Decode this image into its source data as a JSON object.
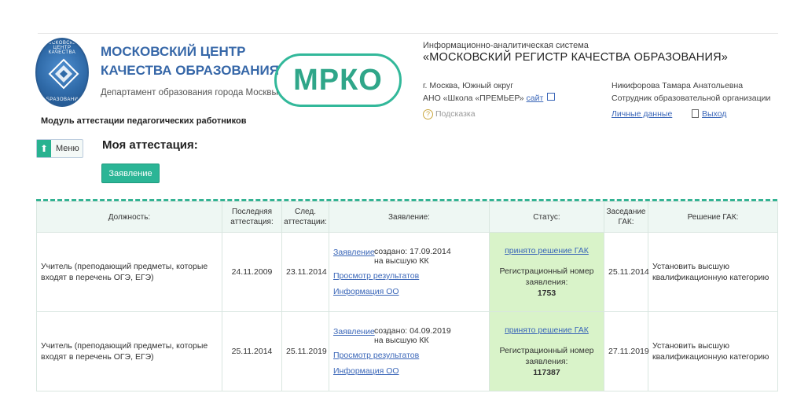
{
  "logo": {
    "ring_top": "МОСКОВСКИЙ ЦЕНТР КАЧЕСТВА",
    "ring_bottom": "ОБРАЗОВАНИЯ"
  },
  "header": {
    "org_line1": "МОСКОВСКИЙ ЦЕНТР",
    "org_line2": "КАЧЕСТВА ОБРАЗОВАНИЯ",
    "org_dept": "Департамент образования города Москвы",
    "mrko": "МРКО",
    "system_subtitle": "Информационно-аналитическая система",
    "system_title": "«МОСКОВСКИЙ РЕГИСТР КАЧЕСТВА ОБРАЗОВАНИЯ»",
    "location": "г. Москва, Южный округ",
    "school": "АНО «Школа «ПРЕМЬЕР»",
    "site_link": "сайт",
    "user_name": "Никифорова Тамара Анатольевна",
    "user_role": "Сотрудник образовательной организации",
    "hint": "Подсказка",
    "personal_data": "Личные данные",
    "exit": "Выход",
    "module_title": "Модуль аттестации педагогических работников"
  },
  "controls": {
    "menu_label": "Меню",
    "page_title": "Моя аттестация:",
    "application_button": "Заявление"
  },
  "table": {
    "headers": {
      "position": "Должность:",
      "last_att_1": "Последняя",
      "last_att_2": "аттестация:",
      "next_att_1": "След.",
      "next_att_2": "аттестации:",
      "application": "Заявление:",
      "status": "Статус:",
      "meeting_1": "Заседание",
      "meeting_2": "ГАК:",
      "decision": "Решение ГАК:"
    },
    "rows": [
      {
        "position": "Учитель (преподающий предметы, которые входят в перечень ОГЭ, ЕГЭ)",
        "last": "24.11.2009",
        "next": "23.11.2014",
        "link_app": "Заявление",
        "created": "создано: 17.09.2014",
        "created_for": "на высшую КК",
        "link_results": "Просмотр результатов",
        "link_info": "Информация ОО",
        "status_link": "принято решение ГАК",
        "reg_label": "Регистрационный номер заявления:",
        "reg_number": "1753",
        "meeting": "25.11.2014",
        "decision": "Установить высшую квалификационную категорию"
      },
      {
        "position": "Учитель (преподающий предметы, которые входят в перечень ОГЭ, ЕГЭ)",
        "last": "25.11.2014",
        "next": "25.11.2019",
        "link_app": "Заявление",
        "created": "создано: 04.09.2019",
        "created_for": "на высшую КК",
        "link_results": "Просмотр результатов",
        "link_info": "Информация ОО",
        "status_link": "принято решение ГАК",
        "reg_label": "Регистрационный номер заявления:",
        "reg_number": "117387",
        "meeting": "27.11.2019",
        "decision": "Установить высшую квалификационную категорию"
      }
    ]
  },
  "colors": {
    "accent": "#2bb596",
    "link": "#3a66b8",
    "status_bg": "#d9f3c9",
    "org_blue": "#3667a8"
  }
}
